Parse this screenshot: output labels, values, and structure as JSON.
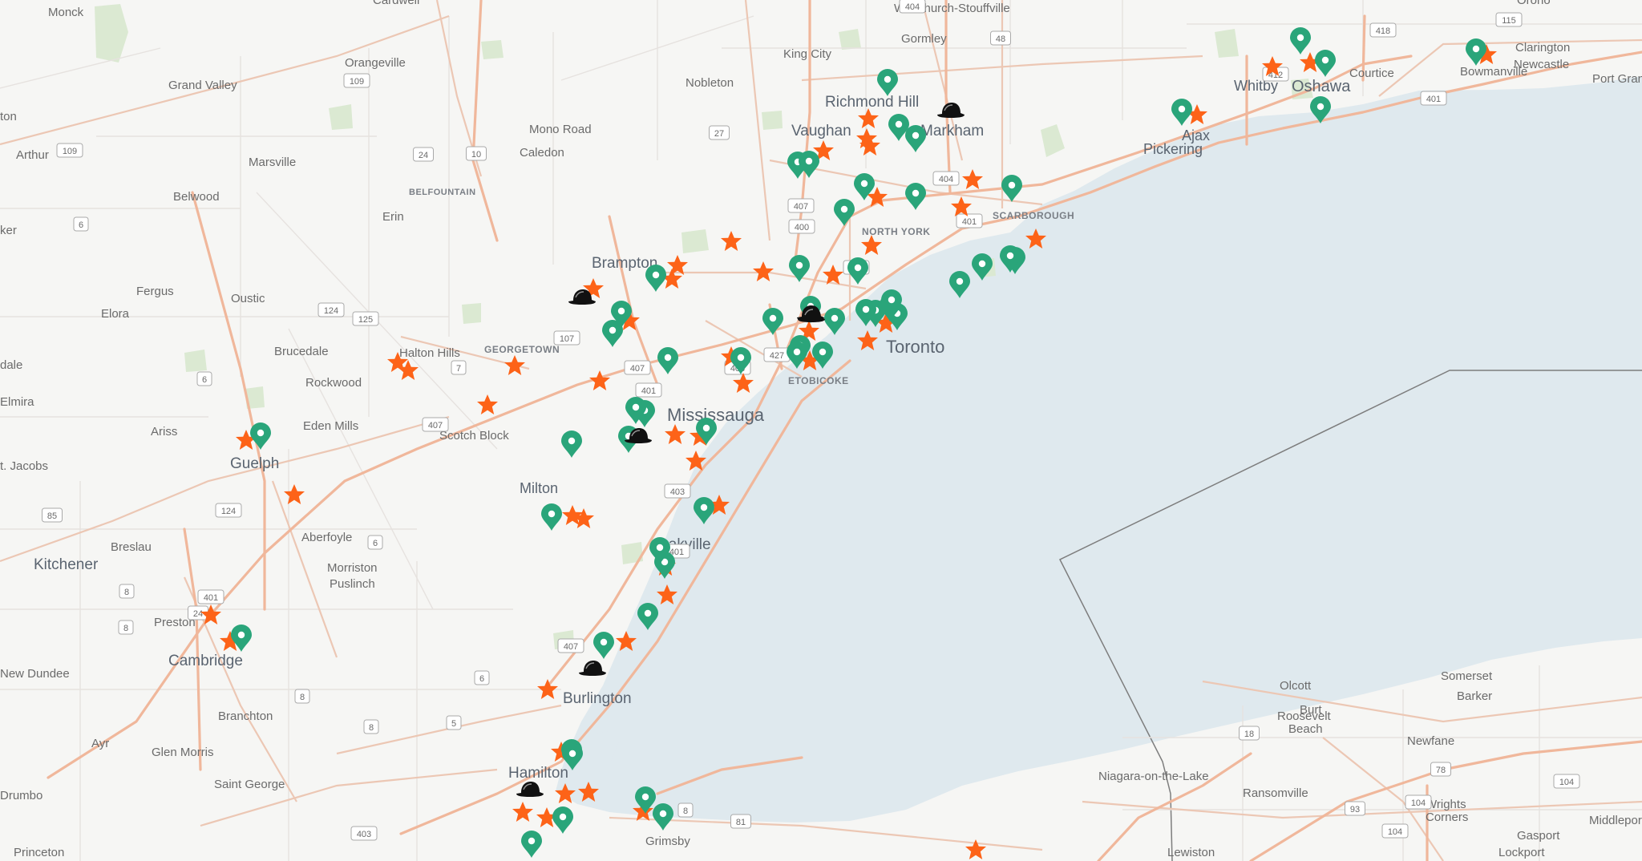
{
  "map": {
    "colors": {
      "land": "#f6f6f4",
      "water": "#dfe9ee",
      "park": "#dbe9d2",
      "minor_road": "#e6e2df",
      "major_road": "#ecc7b4",
      "highway": "#f0b79b",
      "border": "#7d7d7d",
      "label": "#6b6b6b",
      "star_marker": "#fd6318",
      "pin_marker": "#2aa57a",
      "hat_marker": "#111111"
    },
    "place_labels": [
      {
        "text": "Monck",
        "class": "minor"
      },
      {
        "text": "Cardwell",
        "class": "minor"
      },
      {
        "text": "Whitchurch-Stouffville",
        "class": "minor"
      },
      {
        "text": "Gormley",
        "class": "minor"
      },
      {
        "text": "Orono",
        "class": "minor"
      },
      {
        "text": "Clarington",
        "class": "minor"
      },
      {
        "text": "Newcastle",
        "class": "minor"
      },
      {
        "text": "Port Gran",
        "class": "minor"
      },
      {
        "text": "Courtice",
        "class": "minor"
      },
      {
        "text": "Bowmanville",
        "class": "minor"
      },
      {
        "text": "Whitby",
        "class": "medium"
      },
      {
        "text": "Oshawa",
        "class": "medium"
      },
      {
        "text": "Ajax",
        "class": "medium"
      },
      {
        "text": "Pickering",
        "class": "medium"
      },
      {
        "text": "Orangeville",
        "class": "minor"
      },
      {
        "text": "Grand Valley",
        "class": "minor"
      },
      {
        "text": "King City",
        "class": "minor"
      },
      {
        "text": "Nobleton",
        "class": "minor"
      },
      {
        "text": "Richmond Hill",
        "class": "medium"
      },
      {
        "text": "Markham",
        "class": "medium"
      },
      {
        "text": "Vaughan",
        "class": "medium"
      },
      {
        "text": "Mono Road",
        "class": "minor"
      },
      {
        "text": "Caledon",
        "class": "minor"
      },
      {
        "text": "ton",
        "class": "minor"
      },
      {
        "text": "Arthur",
        "class": "minor"
      },
      {
        "text": "Marsville",
        "class": "minor"
      },
      {
        "text": "Belwood",
        "class": "minor"
      },
      {
        "text": "BELFOUNTAIN",
        "class": "district"
      },
      {
        "text": "Erin",
        "class": "minor"
      },
      {
        "text": "ker",
        "class": "minor"
      },
      {
        "text": "NORTH YORK",
        "class": "district"
      },
      {
        "text": "SCARBOROUGH",
        "class": "district"
      },
      {
        "text": "Brampton",
        "class": "medium"
      },
      {
        "text": "Fergus",
        "class": "minor"
      },
      {
        "text": "Oustic",
        "class": "minor"
      },
      {
        "text": "Elora",
        "class": "minor"
      },
      {
        "text": "Brucedale",
        "class": "minor"
      },
      {
        "text": "Halton Hills",
        "class": "minor"
      },
      {
        "text": "GEORGETOWN",
        "class": "district"
      },
      {
        "text": "Toronto",
        "class": "major"
      },
      {
        "text": "dale",
        "class": "minor"
      },
      {
        "text": "ETOBICOKE",
        "class": "district"
      },
      {
        "text": "Rockwood",
        "class": "minor"
      },
      {
        "text": "Elmira",
        "class": "minor"
      },
      {
        "text": "Mississauga",
        "class": "major"
      },
      {
        "text": "Eden Mills",
        "class": "minor"
      },
      {
        "text": "Ariss",
        "class": "minor"
      },
      {
        "text": "Scotch Block",
        "class": "minor"
      },
      {
        "text": "Guelph",
        "class": "medium"
      },
      {
        "text": "t. Jacobs",
        "class": "minor"
      },
      {
        "text": "Milton",
        "class": "medium"
      },
      {
        "text": "Aberfoyle",
        "class": "minor"
      },
      {
        "text": "Breslau",
        "class": "minor"
      },
      {
        "text": "Oakville",
        "class": "medium"
      },
      {
        "text": "Kitchener",
        "class": "medium"
      },
      {
        "text": "Morriston",
        "class": "minor"
      },
      {
        "text": "Puslinch",
        "class": "minor"
      },
      {
        "text": "Preston",
        "class": "minor"
      },
      {
        "text": "Cambridge",
        "class": "medium"
      },
      {
        "text": "New Dundee",
        "class": "minor"
      },
      {
        "text": "Olcott",
        "class": "minor"
      },
      {
        "text": "Somerset",
        "class": "minor"
      },
      {
        "text": "Barker",
        "class": "minor"
      },
      {
        "text": "Burlington",
        "class": "medium"
      },
      {
        "text": "Burt",
        "class": "minor"
      },
      {
        "text": "Roosevelt",
        "class": "minor"
      },
      {
        "text": "Beach",
        "class": "minor"
      },
      {
        "text": "Branchton",
        "class": "minor"
      },
      {
        "text": "Newfane",
        "class": "minor"
      },
      {
        "text": "Ayr",
        "class": "minor"
      },
      {
        "text": "Glen Morris",
        "class": "minor"
      },
      {
        "text": "Hamilton",
        "class": "medium"
      },
      {
        "text": "Niagara-on-the-Lake",
        "class": "minor"
      },
      {
        "text": "Ransomville",
        "class": "minor"
      },
      {
        "text": "Saint George",
        "class": "minor"
      },
      {
        "text": "Wrights",
        "class": "minor"
      },
      {
        "text": "Corners",
        "class": "minor"
      },
      {
        "text": "Drumbo",
        "class": "minor"
      },
      {
        "text": "Middlepor",
        "class": "minor"
      },
      {
        "text": "Gasport",
        "class": "minor"
      },
      {
        "text": "Grimsby",
        "class": "minor"
      },
      {
        "text": "Princeton",
        "class": "minor"
      },
      {
        "text": "Lewiston",
        "class": "minor"
      },
      {
        "text": "Lockport",
        "class": "minor"
      }
    ],
    "highway_shields": [
      "404",
      "48",
      "115",
      "418",
      "412",
      "401",
      "109",
      "10",
      "24",
      "109",
      "27",
      "407",
      "400",
      "404",
      "401",
      "401",
      "6",
      "124",
      "125",
      "7",
      "107",
      "407",
      "401",
      "403",
      "427",
      "6",
      "407",
      "403",
      "401",
      "6",
      "124",
      "85",
      "8",
      "401",
      "24",
      "407",
      "6",
      "8",
      "5",
      "8",
      "403",
      "18",
      "104",
      "93",
      "104",
      "78",
      "104",
      "81",
      "8",
      "8"
    ],
    "markers": {
      "stars": 52,
      "pins": 55,
      "hats": 7
    }
  }
}
